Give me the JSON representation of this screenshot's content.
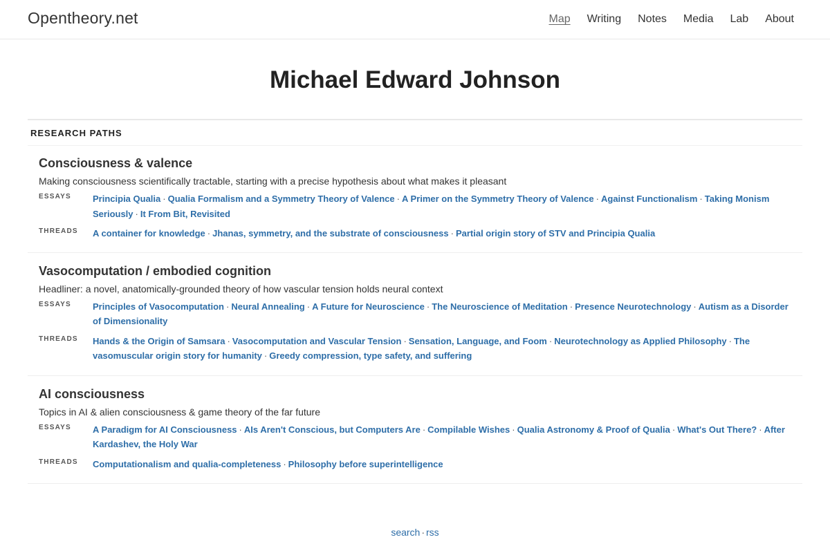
{
  "header": {
    "brand": "Opentheory.net",
    "nav": [
      {
        "label": "Map",
        "active": true
      },
      {
        "label": "Writing"
      },
      {
        "label": "Notes"
      },
      {
        "label": "Media"
      },
      {
        "label": "Lab"
      },
      {
        "label": "About"
      }
    ]
  },
  "page_title": "Michael Edward Johnson",
  "section_label": "RESEARCH PATHS",
  "paths": [
    {
      "title": "Consciousness & valence",
      "description": "Making consciousness scientifically tractable, starting with a precise hypothesis about what makes it pleasant",
      "essays_label": "ESSAYS",
      "essays": [
        "Principia Qualia",
        "Qualia Formalism and a Symmetry Theory of Valence",
        "A Primer on the Symmetry Theory of Valence",
        "Against Functionalism",
        "Taking Monism Seriously",
        "It From Bit, Revisited"
      ],
      "threads_label": "THREADS",
      "threads": [
        "A container for knowledge",
        "Jhanas, symmetry, and the substrate of consciousness",
        "Partial origin story of STV and Principia Qualia"
      ]
    },
    {
      "title": "Vasocomputation / embodied cognition",
      "description": "Headliner: a novel, anatomically-grounded theory of how vascular tension holds neural context",
      "essays_label": "ESSAYS",
      "essays": [
        "Principles of Vasocomputation",
        "Neural Annealing",
        "A Future for Neuroscience",
        "The Neuroscience of Meditation",
        "Presence Neurotechnology",
        "Autism as a Disorder of Dimensionality"
      ],
      "threads_label": "THREADS",
      "threads": [
        "Hands & the Origin of Samsara",
        "Vasocomputation and Vascular Tension",
        "Sensation, Language, and Foom",
        "Neurotechnology as Applied Philosophy",
        "The vasomuscular origin story for humanity",
        "Greedy compression, type safety, and suffering"
      ]
    },
    {
      "title": "AI consciousness",
      "description": "Topics in AI & alien consciousness & game theory of the far future",
      "essays_label": "ESSAYS",
      "essays": [
        "A Paradigm for AI Consciousness",
        "AIs Aren't Conscious, but Computers Are",
        "Compilable Wishes",
        "Qualia Astronomy & Proof of Qualia",
        "What's Out There?",
        "After Kardashev, the Holy War"
      ],
      "threads_label": "THREADS",
      "threads": [
        "Computationalism and qualia-completeness",
        "Philosophy before superintelligence"
      ]
    }
  ],
  "footer": {
    "links": [
      "search",
      "rss"
    ],
    "separator": "·"
  },
  "colors": {
    "link": "#2e6ea8",
    "text": "#333333",
    "divider": "#e8e8e8"
  }
}
